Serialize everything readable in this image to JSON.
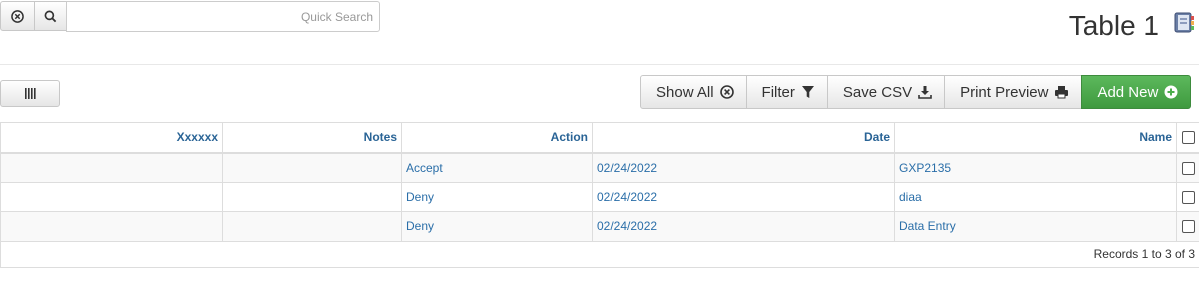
{
  "search": {
    "placeholder": "Quick Search",
    "value": ""
  },
  "header": {
    "title": "Table 1"
  },
  "toolbar": {
    "show_all": "Show All",
    "filter": "Filter",
    "save_csv": "Save CSV",
    "print_preview": "Print Preview",
    "add_new": "Add New",
    "add_new_color": "#4cae4c"
  },
  "table": {
    "columns": [
      "Xxxxxx",
      "Notes",
      "Action",
      "Date",
      "Name"
    ],
    "rows": [
      {
        "xxxxxx": "",
        "notes": "",
        "action": "Accept",
        "date": "02/24/2022",
        "name": "GXP2135"
      },
      {
        "xxxxxx": "",
        "notes": "",
        "action": "Deny",
        "date": "02/24/2022",
        "name": "diaa"
      },
      {
        "xxxxxx": "",
        "notes": "",
        "action": "Deny",
        "date": "02/24/2022",
        "name": "Data Entry"
      }
    ],
    "footer": "Records 1 to 3 of 3"
  },
  "colors": {
    "link": "#2a6ea8",
    "header_text": "#2a6496"
  }
}
